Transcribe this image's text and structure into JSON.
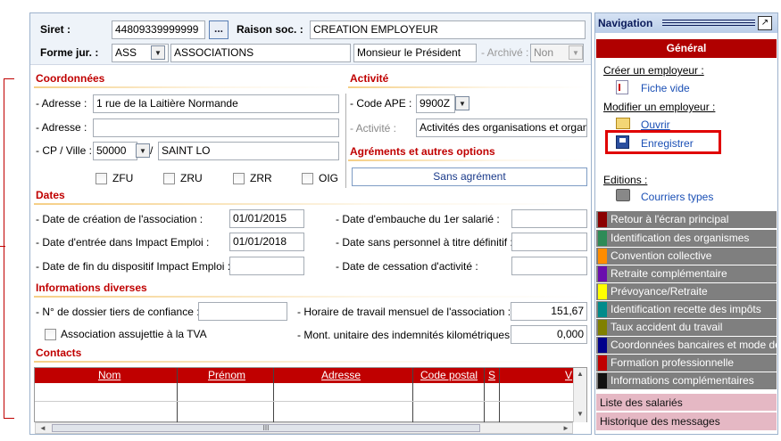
{
  "header": {
    "siret_label": "Siret :",
    "siret_value": "44809339999999",
    "ellipsis": "...",
    "raison_label": "Raison soc. :",
    "raison_value": "CREATION EMPLOYEUR",
    "forme_label": "Forme jur. :",
    "forme_code": "ASS",
    "forme_value": "ASSOCIATIONS",
    "title_value": "Monsieur le Président",
    "archive_label": "- Archivé :",
    "archive_value": "Non"
  },
  "coordonnees": {
    "title": "Coordonnées",
    "adresse1_label": "- Adresse :",
    "adresse1_value": "1 rue de la Laitière Normande",
    "adresse2_label": "- Adresse :",
    "adresse2_value": "",
    "cpville_label": "- CP / Ville :",
    "cp_value": "50000",
    "slash": "/",
    "ville_value": "SAINT LO",
    "checkboxes": [
      "ZFU",
      "ZRU",
      "ZRR",
      "OIG"
    ]
  },
  "activite": {
    "title": "Activité",
    "codeape_label": "- Code APE :",
    "codeape_value": "9900Z",
    "activite_label": "- Activité :",
    "activite_value": "Activités des organisations et organismes",
    "agrements_title": "Agréments et autres options",
    "agrement_value": "Sans agrément"
  },
  "dates": {
    "title": "Dates",
    "creation_label": "- Date de création de l'association :",
    "creation_value": "01/01/2015",
    "entree_label": "- Date d'entrée dans Impact Emploi :",
    "entree_value": "01/01/2018",
    "fin_label": "- Date de fin du dispositif Impact Emploi :",
    "fin_value": "",
    "embauche_label": "- Date d'embauche du 1er salarié :",
    "sans_personnel_label": "- Date sans personnel à titre définitif :",
    "cessation_label": "- Date de cessation d'activité :"
  },
  "infos": {
    "title": "Informations diverses",
    "dossier_label": "- N° de dossier tiers de confiance :",
    "dossier_value": "",
    "horaire_label": "- Horaire de travail mensuel de l'association :",
    "horaire_value": "151,67",
    "tva_label": "Association assujettie à la TVA",
    "montant_label": "- Mont. unitaire des indemnités kilométriques :",
    "montant_value": "0,000"
  },
  "contacts": {
    "title": "Contacts",
    "columns": [
      "Nom",
      "Prénom",
      "Adresse",
      "Code postal",
      "S",
      "V"
    ],
    "scroll_mark": "III"
  },
  "navigation": {
    "title": "Navigation",
    "general": "Général",
    "creer_label": "Créer un employeur :",
    "fiche_vide": "Fiche vide",
    "modifier_label": "Modifier un employeur :",
    "ouvrir": "Ouvrir",
    "enregistrer": "Enregistrer",
    "editions_label": "Editions :",
    "courriers": "Courriers types",
    "items": [
      {
        "label": "Retour à l'écran principal",
        "color": "#8b0000"
      },
      {
        "label": "Identification des organismes",
        "color": "#2e8b57"
      },
      {
        "label": "Convention collective",
        "color": "#ff8c00"
      },
      {
        "label": "Retraite complémentaire",
        "color": "#6a0dad"
      },
      {
        "label": "Prévoyance/Retraite",
        "color": "#ffff00"
      },
      {
        "label": "Identification recette des impôts",
        "color": "#008b8b"
      },
      {
        "label": "Taux accident du travail",
        "color": "#808000"
      },
      {
        "label": "Coordonnées bancaires et mode de",
        "color": "#00008b"
      },
      {
        "label": "Formation professionnelle",
        "color": "#c00000"
      },
      {
        "label": "Informations complémentaires",
        "color": "#111111"
      }
    ],
    "bottom_items": [
      "Liste des salariés",
      "Historique des messages"
    ]
  }
}
